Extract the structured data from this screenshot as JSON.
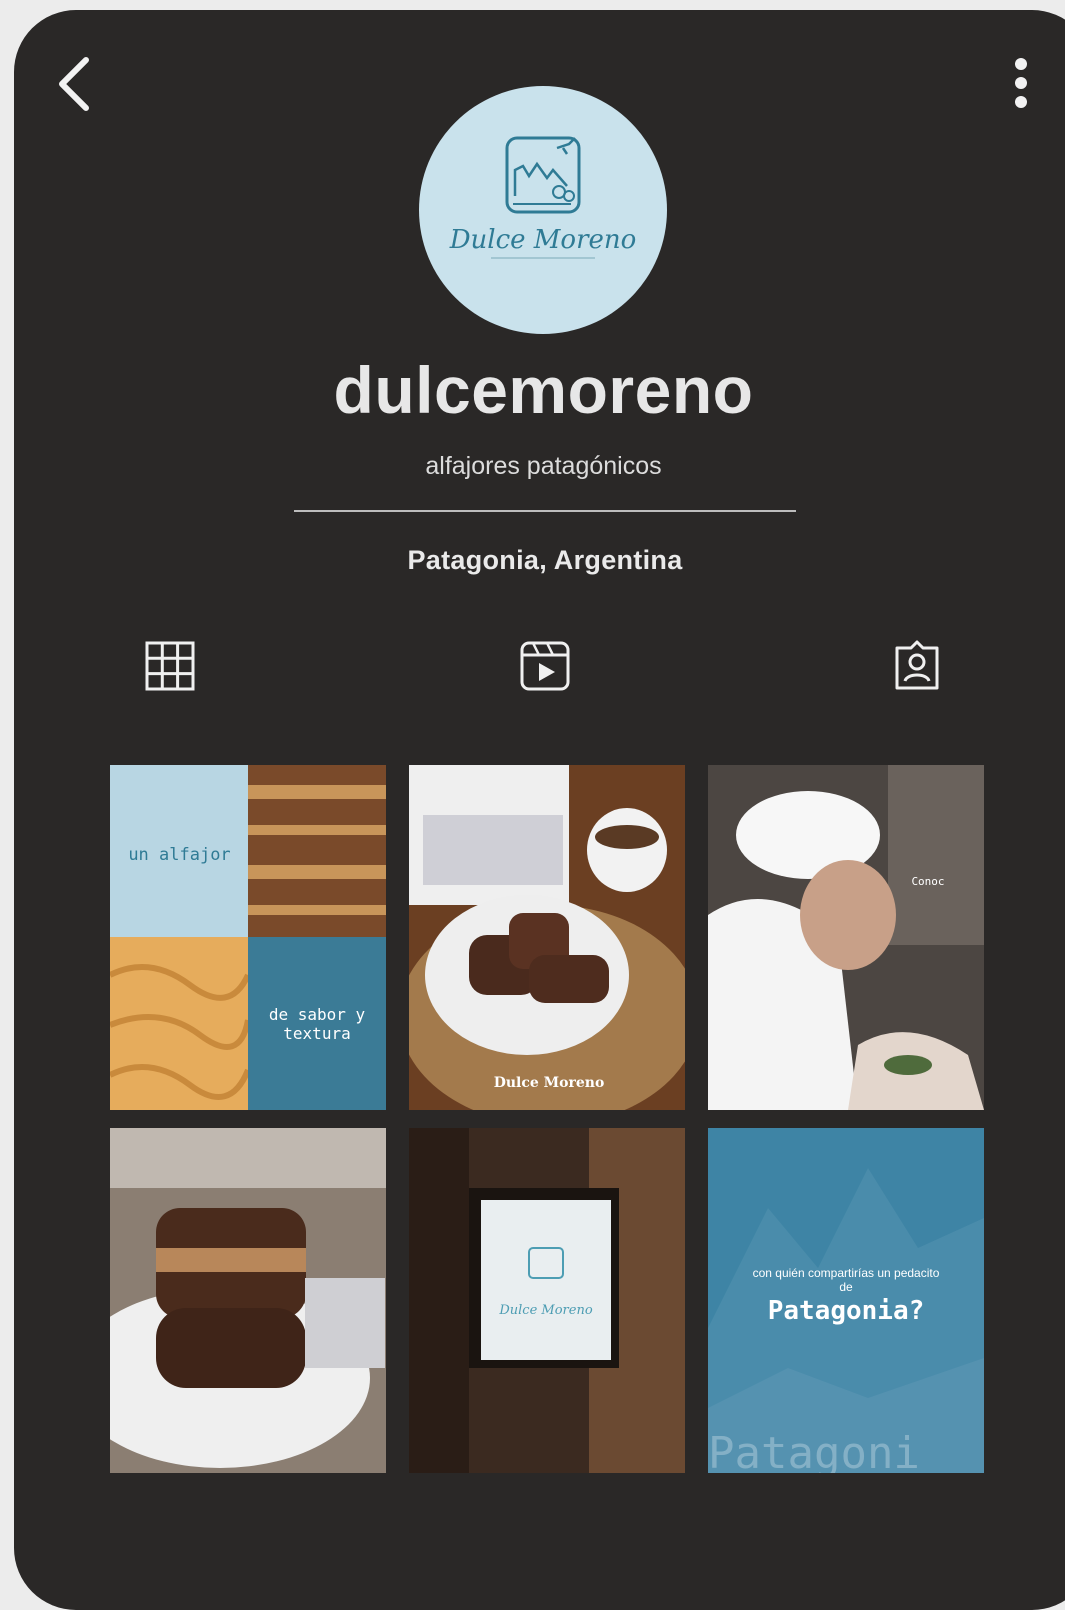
{
  "profile": {
    "username": "dulcemoreno",
    "bio": "alfajores patagónicos",
    "location": "Patagonia, Argentina",
    "avatar_logo_text": "Dulce Moreno"
  },
  "header": {
    "back_icon": "chevron-left-icon",
    "menu_icon": "vertical-dots-icon"
  },
  "tabs": [
    {
      "icon": "grid-icon",
      "selected": true
    },
    {
      "icon": "reels-icon",
      "selected": false
    },
    {
      "icon": "tagged-icon",
      "selected": false
    }
  ],
  "posts": [
    {
      "alt": "Post 1",
      "text_top": "un alfajor",
      "text_bottom": "de sabor y textura"
    },
    {
      "alt": "Post 2",
      "caption": "Dulce Moreno"
    },
    {
      "alt": "Post 3",
      "caption": "Conoc"
    },
    {
      "alt": "Post 4"
    },
    {
      "alt": "Post 5",
      "sign_text": "Dulce Moreno"
    },
    {
      "alt": "Post 6",
      "text_small": "con quién compartirías un pedacito de",
      "text_big": "Patagonia?",
      "watermark": "Patagoni"
    }
  ],
  "colors": {
    "background": "#2a2827",
    "page": "#ececec",
    "avatar": "#c9e2ec",
    "brand_blue": "#2f7b95",
    "text": "#e7e7e7"
  }
}
